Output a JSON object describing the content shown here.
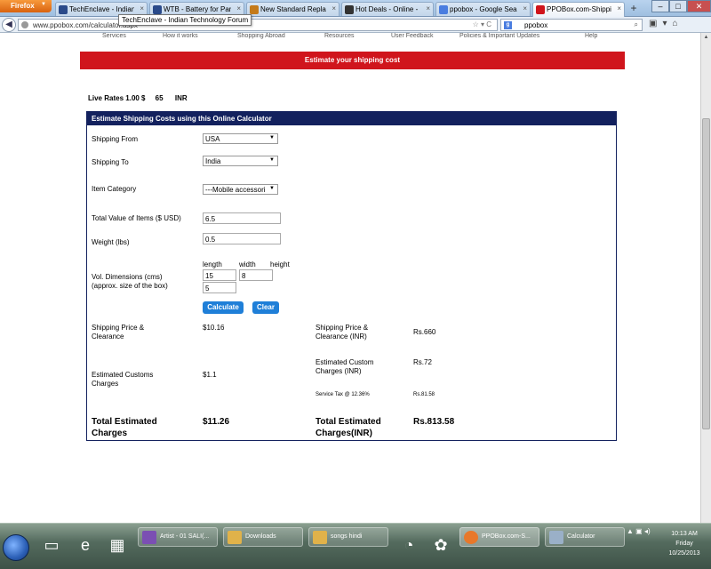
{
  "browser": {
    "menu_button": "Firefox",
    "tabs": [
      {
        "title": "TechEnclave - Indian ...",
        "favicon_color": "#2a4a8a",
        "active": false
      },
      {
        "title": "WTB - Battery for Pant...",
        "favicon_color": "#2a4a8a",
        "active": false
      },
      {
        "title": "New Standard Replace...",
        "favicon_color": "#c47a1a",
        "active": false
      },
      {
        "title": "Hot Deals - Online - D...",
        "favicon_color": "#333333",
        "active": false
      },
      {
        "title": "ppobox - Google Search",
        "favicon_color": "#4a7de0",
        "active": false
      },
      {
        "title": "PPOBox.com-Shippin...",
        "favicon_color": "#d0151c",
        "active": true
      }
    ],
    "new_tab": "+",
    "window_buttons": {
      "minimize": "–",
      "maximize": "□",
      "close": "✕"
    },
    "tooltip": "TechEnclave - Indian Technology Forum",
    "url": "www.ppobox.com/calculator.aspx",
    "search": {
      "engine": "g",
      "text": "ppobox"
    }
  },
  "site": {
    "top_nav": [
      "Services",
      "How it works",
      "Shopping Abroad",
      "Resources",
      "User Feedback",
      "Policies & Important Updates",
      "Help"
    ],
    "banner": "Estimate your shipping cost",
    "live_rates": {
      "label": "Live Rates",
      "usd": "1.00 $",
      "inr": "65",
      "unit": "INR"
    }
  },
  "calculator": {
    "header": "Estimate Shipping Costs using this Online Calculator",
    "shipping_from": {
      "label": "Shipping From",
      "value": "USA"
    },
    "shipping_to": {
      "label": "Shipping To",
      "value": "India"
    },
    "item_category": {
      "label": "Item Category",
      "value": "---Mobile accessori"
    },
    "total_value": {
      "label": "Total Value of Items ($ USD)",
      "value": "6.5"
    },
    "weight": {
      "label": "Weight (lbs)",
      "value": "0.5"
    },
    "dimensions": {
      "label": "Vol. Dimensions (cms)",
      "sublabel": "(approx. size of the box)",
      "length_label": "length",
      "width_label": "width",
      "height_label": "height",
      "length": "15",
      "width": "8",
      "height": "5"
    },
    "calculate_label": "Calculate",
    "clear_label": "Clear",
    "results": {
      "shipping_price_label_1": "Shipping Price &",
      "shipping_price_label_2": "Clearance",
      "shipping_price": "$10.16",
      "shipping_price_inr_label_1": "Shipping Price &",
      "shipping_price_inr_label_2": "Clearance (INR)",
      "shipping_price_inr": "Rs.660",
      "custom_charges_inr_label_1": "Estimated Custom",
      "custom_charges_inr_label_2": "Charges (INR)",
      "custom_charges_inr": "Rs.72",
      "service_tax_label": "Service Tax @ 12.36%",
      "service_tax": "Rs.81.58",
      "customs_label_1": "Estimated Customs",
      "customs_label_2": "Charges",
      "customs": "$1.1",
      "total_label_1": "Total Estimated",
      "total_label_2": "Charges",
      "total": "$11.26",
      "total_inr_label_1": "Total Estimated",
      "total_inr_label_2": "Charges(INR)",
      "total_inr": "Rs.813.58"
    }
  },
  "taskbar": {
    "items": [
      {
        "label": "Artist - 01 SALI(...",
        "icon_color": "#7b4fb3",
        "active": false
      },
      {
        "label": "Downloads",
        "icon_color": "#e0b24a",
        "active": false
      },
      {
        "label": "songs hindi",
        "icon_color": "#e0b24a",
        "active": false
      },
      {
        "label": "PPOBox.com-S...",
        "icon_color": "#e8782a",
        "active": true
      },
      {
        "label": "Calculator",
        "icon_color": "#9ab0c8",
        "active": false
      }
    ],
    "clock": {
      "time": "10:13 AM",
      "day": "Friday",
      "date": "10/25/2013"
    }
  }
}
